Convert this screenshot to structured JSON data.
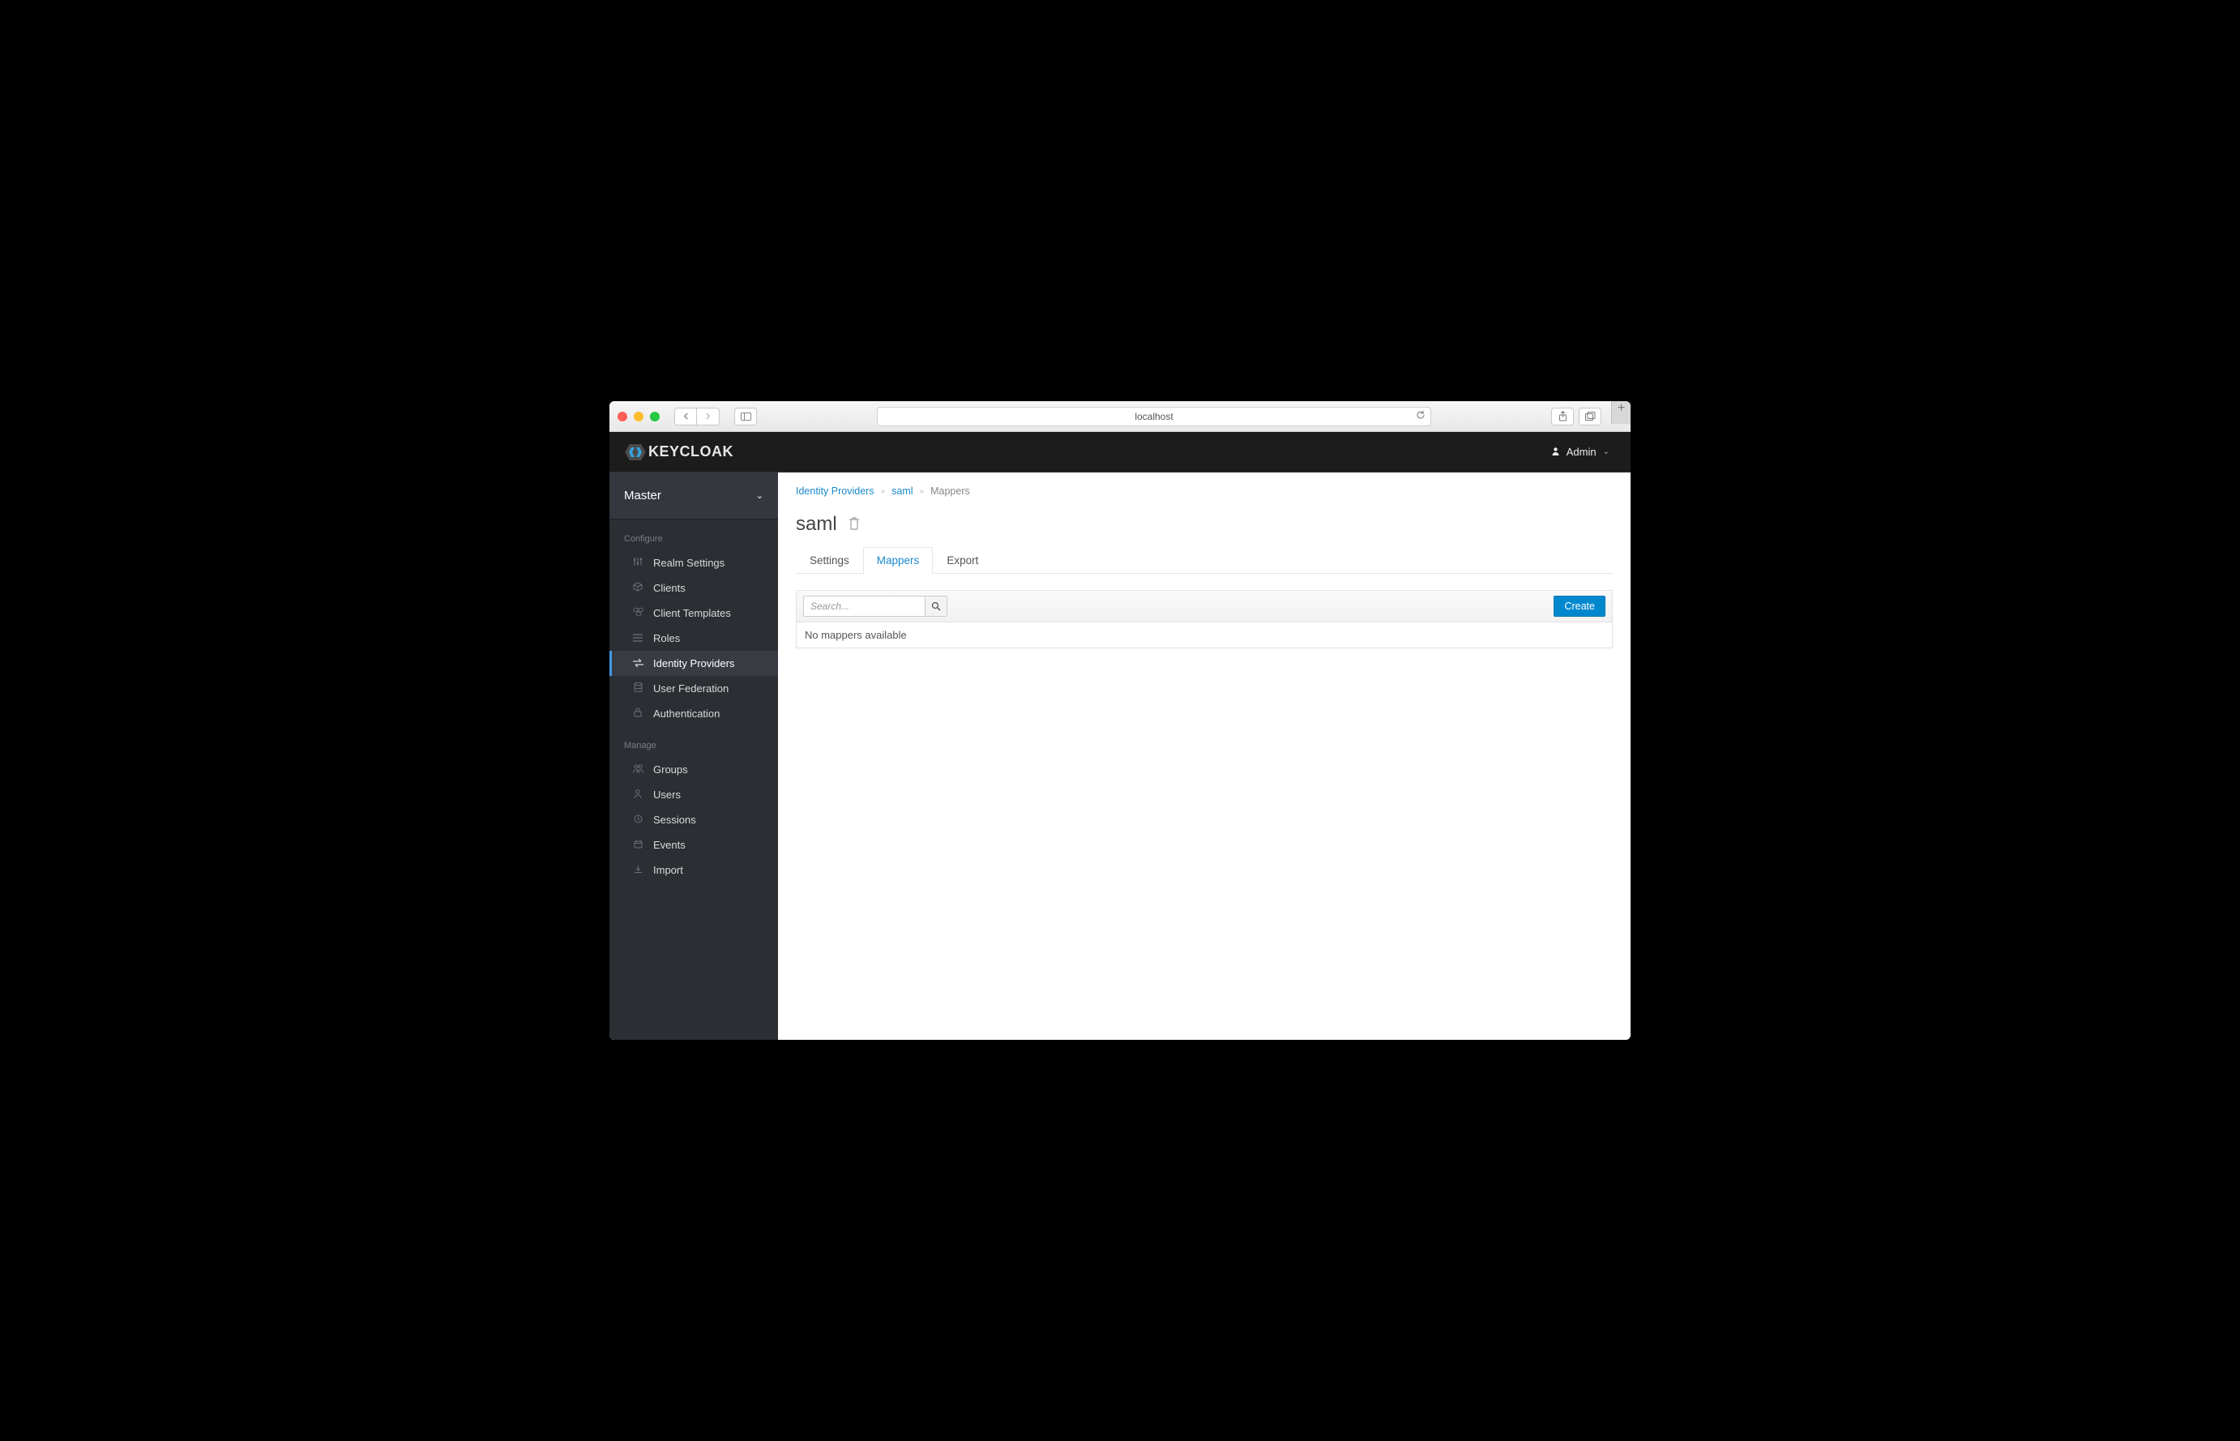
{
  "chrome": {
    "address": "localhost"
  },
  "header": {
    "brand": "KEYCLOAK",
    "user": "Admin"
  },
  "realm": "Master",
  "nav": {
    "configure_heading": "Configure",
    "manage_heading": "Manage",
    "realm_settings": "Realm Settings",
    "clients": "Clients",
    "client_templates": "Client Templates",
    "roles": "Roles",
    "identity_providers": "Identity Providers",
    "user_federation": "User Federation",
    "authentication": "Authentication",
    "groups": "Groups",
    "users": "Users",
    "sessions": "Sessions",
    "events": "Events",
    "import": "Import"
  },
  "breadcrumb": {
    "root": "Identity Providers",
    "provider": "saml",
    "current": "Mappers"
  },
  "page": {
    "title": "saml"
  },
  "tabs": {
    "settings": "Settings",
    "mappers": "Mappers",
    "export": "Export"
  },
  "toolbar": {
    "search_placeholder": "Search...",
    "create": "Create"
  },
  "table": {
    "empty": "No mappers available"
  }
}
